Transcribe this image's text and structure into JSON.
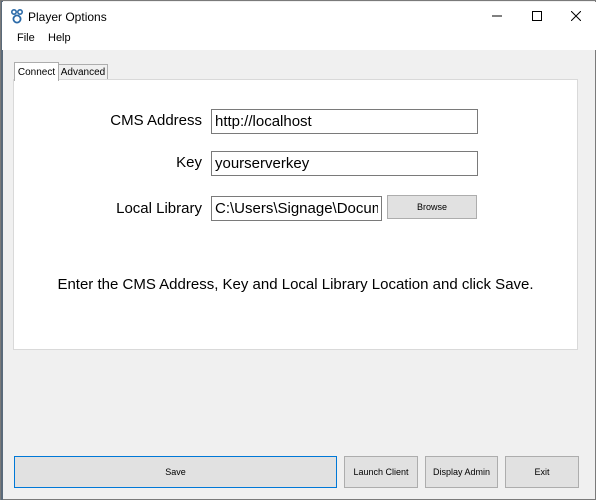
{
  "window": {
    "title": "Player Options",
    "icon": "xibo-player-icon",
    "controls": {
      "minimize": "minimize-icon",
      "maximize": "maximize-icon",
      "close": "close-icon"
    }
  },
  "menu": {
    "items": [
      {
        "label": "File"
      },
      {
        "label": "Help"
      }
    ]
  },
  "tabs": [
    {
      "label": "Connect",
      "selected": true
    },
    {
      "label": "Advanced",
      "selected": false
    }
  ],
  "form": {
    "cms_address": {
      "label": "CMS Address",
      "value": "http://localhost"
    },
    "key": {
      "label": "Key",
      "value": "yourserverkey"
    },
    "local_library": {
      "label": "Local Library",
      "value": "C:\\Users\\Signage\\Documents"
    },
    "browse_label": "Browse"
  },
  "instructions": "Enter the CMS Address, Key and Local Library Location and click Save.",
  "buttons": {
    "save": "Save",
    "launch_client": "Launch Client",
    "display_admin": "Display Admin",
    "exit": "Exit"
  },
  "colors": {
    "accent": "#0078d7",
    "window_bg": "#f0f0f0",
    "panel_bg": "#ffffff",
    "button_bg": "#e1e1e1"
  }
}
